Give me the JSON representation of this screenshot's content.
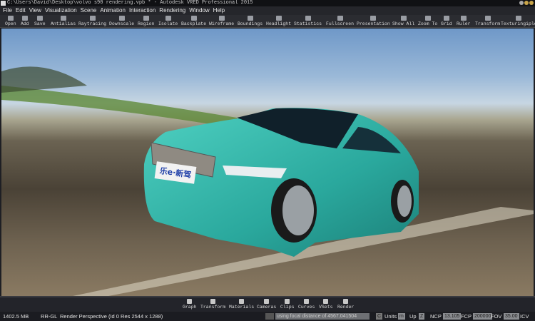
{
  "title": "C:\\Users\\David\\Desktop\\volvo s90 rendering.vpb * - Autodesk VRED Professional 2015",
  "menu": [
    "File",
    "Edit",
    "View",
    "Visualization",
    "Scene",
    "Animation",
    "Interaction",
    "Rendering",
    "Window",
    "Help"
  ],
  "toolbar": [
    "Open",
    "Add",
    "Save",
    "Antialias",
    "Raytracing",
    "Downscale",
    "Region",
    "Isolate",
    "Backplate",
    "Wireframe",
    "Boundings",
    "Headlight",
    "Statistics",
    "Fullscreen",
    "Presentation",
    "Show All",
    "Zoom To",
    "Grid",
    "Ruler",
    "Transform",
    "Texturingiple"
  ],
  "bottom_toolbar": [
    "Graph",
    "Transform",
    "Materials",
    "Cameras",
    "Clips",
    "Curves",
    "VSets",
    "Render"
  ],
  "status": {
    "memory": "1402.5 MB",
    "renderer": "RR-GL",
    "info": "Render Perspective (Id 0 Res 2544 x 1288)",
    "message": "using focal distance of 4567.041504",
    "c_label": "C",
    "units_label": "Units",
    "units_value": "m",
    "up_label": "Up",
    "up_value": "Z",
    "ncp_label": "NCP",
    "ncp_value": "13.105",
    "fcp_label": "FCP",
    "fcp_value": "200000",
    "fov_label": "FOV",
    "fov_value": "35.00",
    "icv_label": "ICV"
  },
  "viewport": {
    "plate_text": "乐e·新驾",
    "car_color": "#2fb3a8"
  }
}
